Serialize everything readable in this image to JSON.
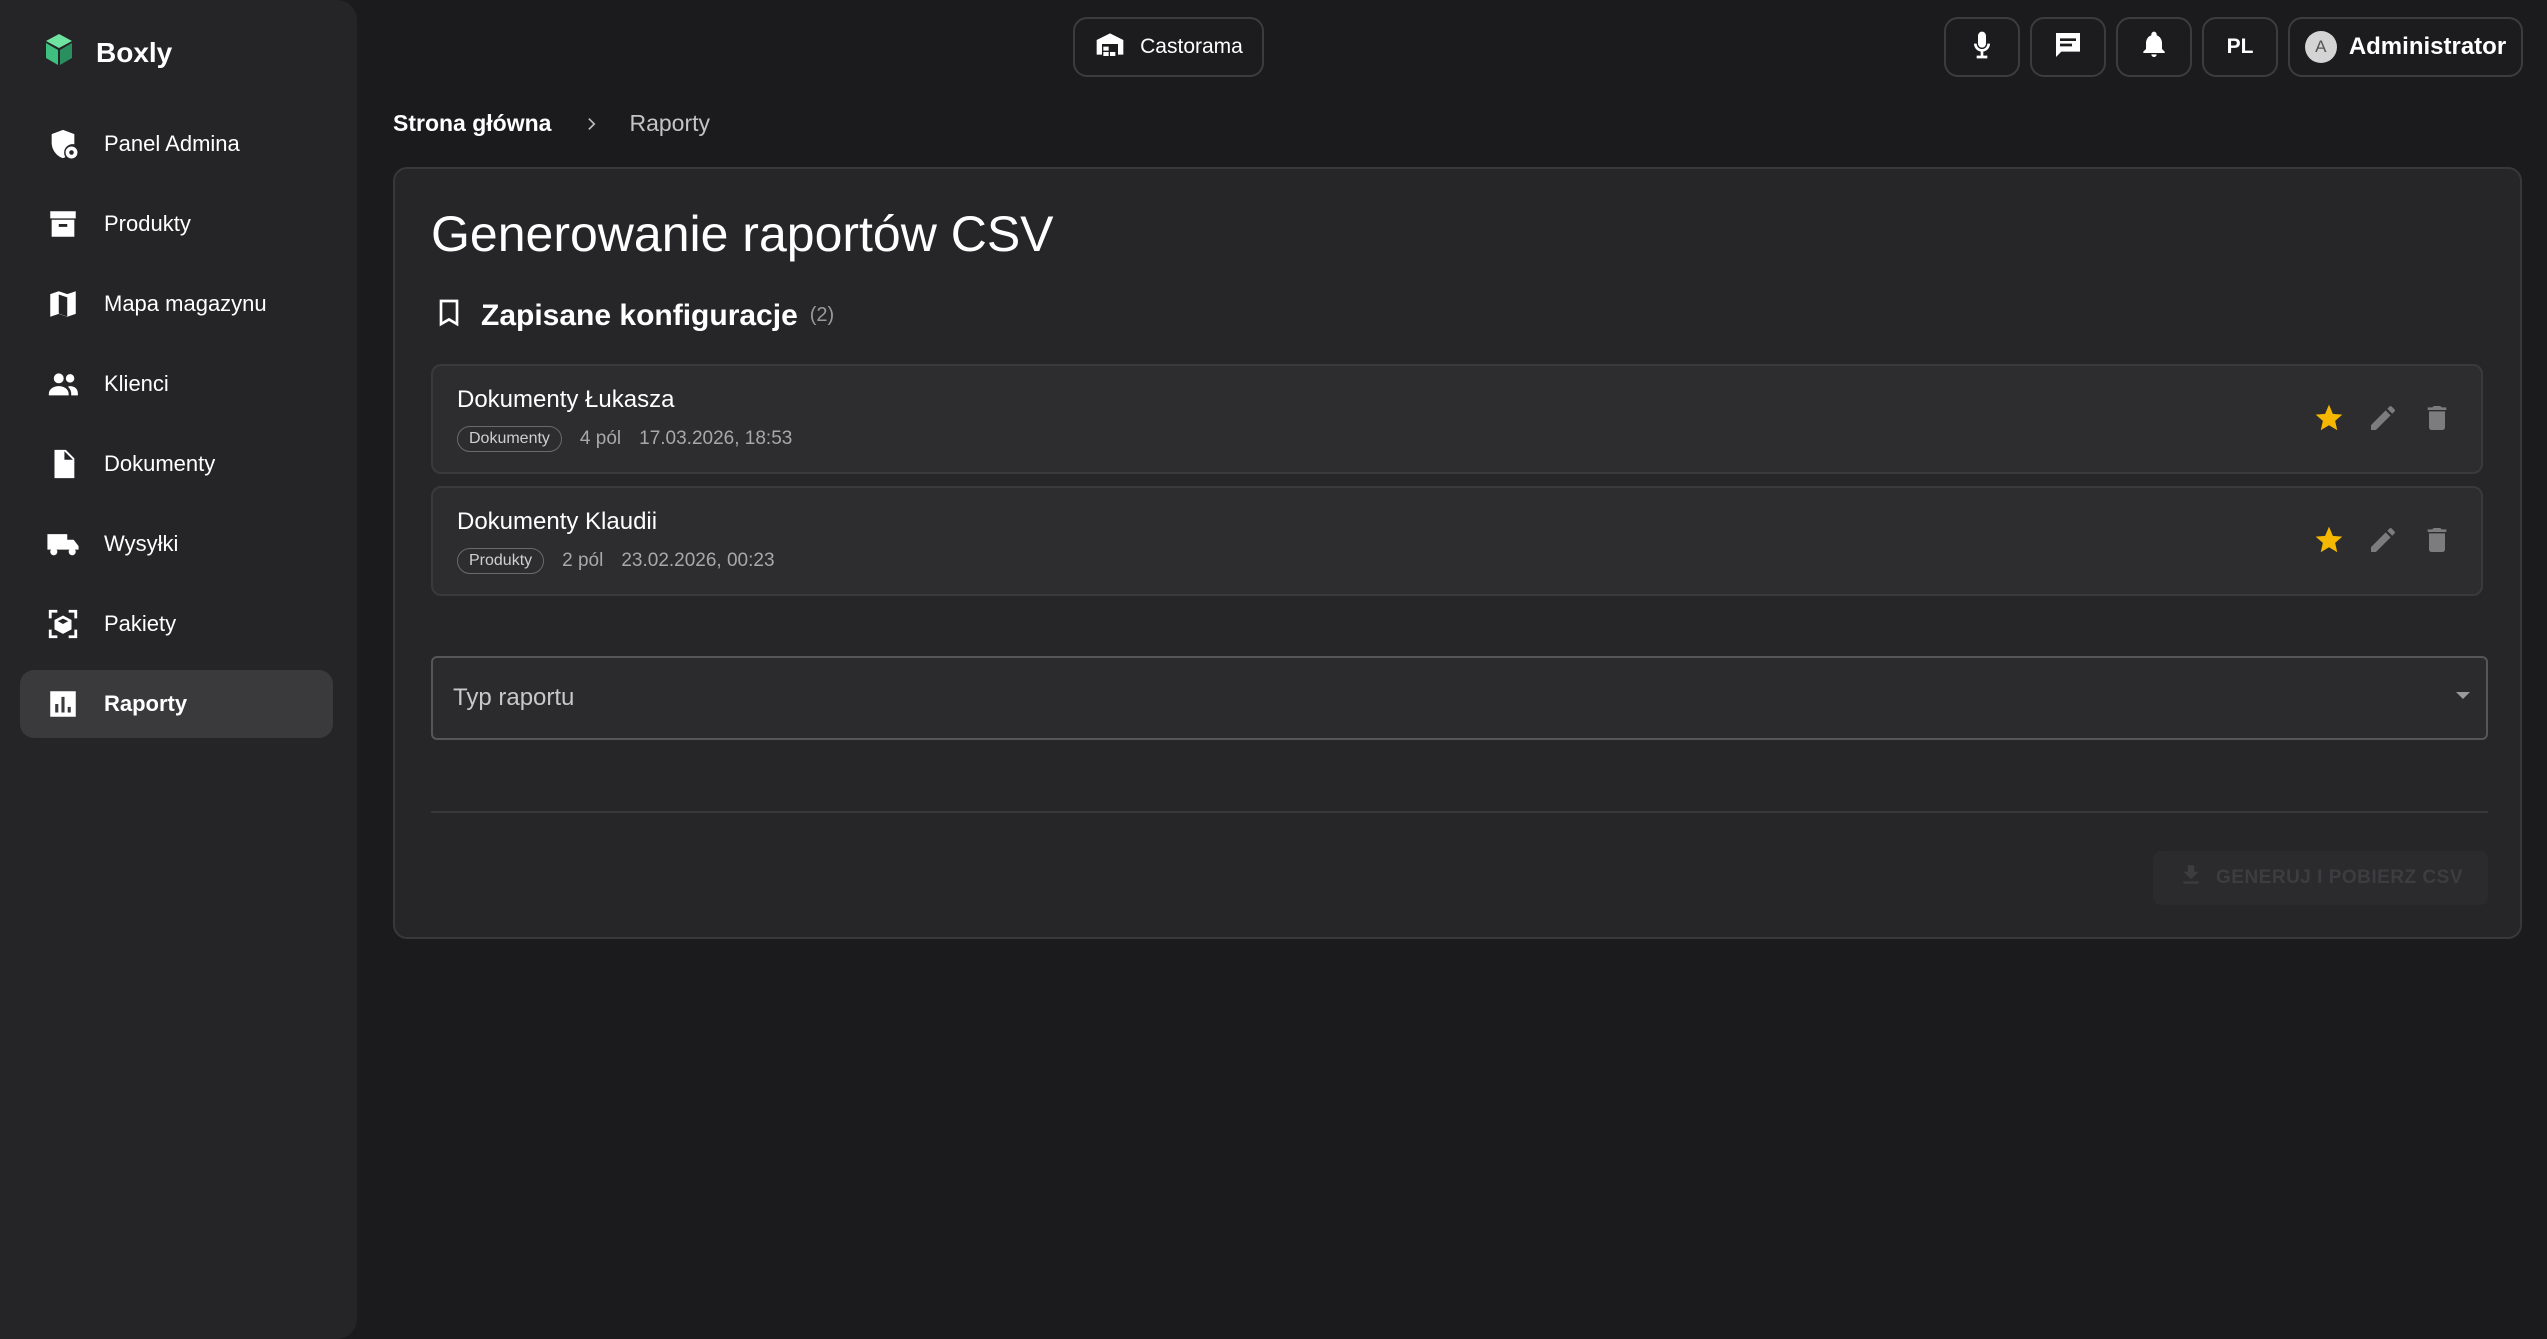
{
  "app": {
    "name": "Boxly",
    "accent_color": "#6fe3a0"
  },
  "sidebar": {
    "items": [
      {
        "label": "Panel Admina",
        "icon": "admin-shield-icon"
      },
      {
        "label": "Produkty",
        "icon": "archive-box-icon"
      },
      {
        "label": "Mapa magazynu",
        "icon": "map-icon"
      },
      {
        "label": "Klienci",
        "icon": "people-icon"
      },
      {
        "label": "Dokumenty",
        "icon": "document-icon"
      },
      {
        "label": "Wysyłki",
        "icon": "truck-icon"
      },
      {
        "label": "Pakiety",
        "icon": "package-scan-icon"
      },
      {
        "label": "Raporty",
        "icon": "bar-chart-icon",
        "active": true
      }
    ]
  },
  "topbar": {
    "warehouse_label": "Castorama",
    "language": "PL",
    "user_initial": "A",
    "user_name": "Administrator"
  },
  "breadcrumb": {
    "home": "Strona główna",
    "current": "Raporty"
  },
  "main": {
    "title": "Generowanie raportów CSV",
    "saved": {
      "title": "Zapisane konfiguracje",
      "count": "(2)",
      "items": [
        {
          "name": "Dokumenty Łukasza",
          "tag": "Dokumenty",
          "fields": "4 pól",
          "date": "17.03.2026, 18:53",
          "favorite": true
        },
        {
          "name": "Dokumenty Klaudii",
          "tag": "Produkty",
          "fields": "2 pól",
          "date": "23.02.2026, 00:23",
          "favorite": true
        }
      ]
    },
    "report_type_label": "Typ raportu",
    "generate_label": "GENERUJ I POBIERZ CSV",
    "star_color": "#f5b700"
  }
}
